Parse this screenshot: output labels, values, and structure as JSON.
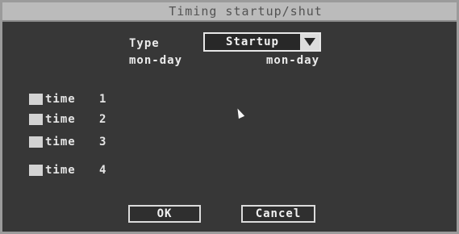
{
  "dialog": {
    "title": "Timing startup/shut"
  },
  "form": {
    "type_label": "Type",
    "type_value": "Startup",
    "range_start_label": "mon-day",
    "range_end_label": "mon-day"
  },
  "times": [
    {
      "label": "time",
      "index": "1"
    },
    {
      "label": "time",
      "index": "2"
    },
    {
      "label": "time",
      "index": "3"
    },
    {
      "label": "time",
      "index": "4"
    }
  ],
  "buttons": {
    "ok": "OK",
    "cancel": "Cancel"
  }
}
